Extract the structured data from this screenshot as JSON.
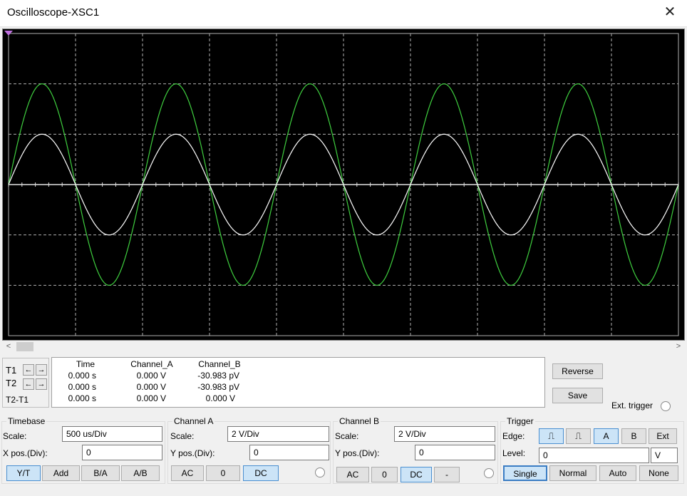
{
  "window": {
    "title": "Oscilloscope-XSC1",
    "close_icon": "close-icon"
  },
  "colors": {
    "screen_bg": "#000000",
    "channel_a": "#ffffff",
    "channel_b": "#3fcf3f",
    "grid": "#b0b0b0"
  },
  "signals": {
    "channel_a": {
      "amplitude_v": 2,
      "period_div": 2,
      "unit": "V"
    },
    "channel_b": {
      "amplitude_v": 4,
      "period_div": 2,
      "unit": "V"
    }
  },
  "cursors": {
    "t1_label": "T1",
    "t2_label": "T2",
    "diff_label": "T2-T1",
    "left_arrow": "←",
    "right_arrow": "→"
  },
  "readout": {
    "headers": [
      "Time",
      "Channel_A",
      "Channel_B"
    ],
    "rows": [
      [
        "0.000 s",
        "0.000 V",
        "-30.983 pV"
      ],
      [
        "0.000 s",
        "0.000 V",
        "-30.983 pV"
      ],
      [
        "0.000 s",
        "0.000 V",
        "0.000 V"
      ]
    ]
  },
  "actions": {
    "reverse": "Reverse",
    "save": "Save",
    "ext_trigger": "Ext. trigger"
  },
  "timebase": {
    "title": "Timebase",
    "scale_label": "Scale:",
    "scale_value": "500 us/Div",
    "xpos_label": "X pos.(Div):",
    "xpos_value": "0",
    "modes": [
      "Y/T",
      "Add",
      "B/A",
      "A/B"
    ],
    "selected_mode": "Y/T"
  },
  "channel_a": {
    "title": "Channel A",
    "scale_label": "Scale:",
    "scale_value": "2  V/Div",
    "ypos_label": "Y pos.(Div):",
    "ypos_value": "0",
    "coupling": [
      "AC",
      "0",
      "DC"
    ],
    "selected": "DC"
  },
  "channel_b": {
    "title": "Channel B",
    "scale_label": "Scale:",
    "scale_value": "2  V/Div",
    "ypos_label": "Y pos.(Div):",
    "ypos_value": "0",
    "coupling": [
      "AC",
      "0",
      "DC",
      "-"
    ],
    "selected": "DC"
  },
  "trigger": {
    "title": "Trigger",
    "edge_label": "Edge:",
    "edge_rising": "rising-edge-icon",
    "edge_falling": "falling-edge-icon",
    "sources": [
      "A",
      "B",
      "Ext"
    ],
    "selected_source": "A",
    "level_label": "Level:",
    "level_value": "0",
    "level_unit": "V",
    "modes": [
      "Single",
      "Normal",
      "Auto",
      "None"
    ],
    "selected_mode": "Single"
  }
}
